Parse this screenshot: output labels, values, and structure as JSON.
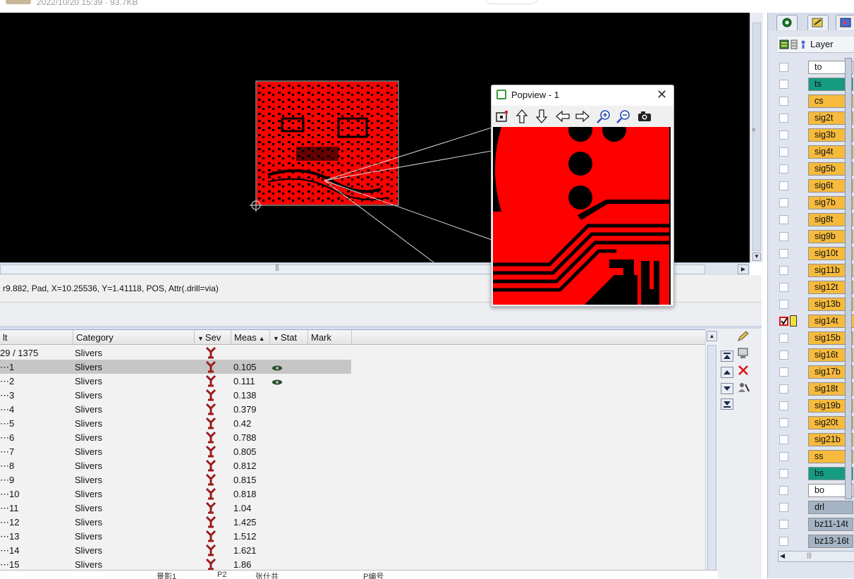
{
  "top_strip": {
    "meta": "2022/10/20 15:39 · 93.7KB"
  },
  "status": {
    "text": "r9.882, Pad, X=10.25536, Y=1.41118, POS, Attr(.drill=via)"
  },
  "popview": {
    "title": "Popview - 1",
    "close": "✕"
  },
  "results": {
    "columns": [
      {
        "label": "lt"
      },
      {
        "label": "Category"
      },
      {
        "label": "Sev"
      },
      {
        "label": "Meas"
      },
      {
        "label": "Stat"
      },
      {
        "label": "Mark"
      }
    ],
    "summary": {
      "count": "29 / 1375",
      "category": "Slivers"
    },
    "rows": [
      {
        "id": "1",
        "category": "Slivers",
        "meas": "0.105",
        "stat": true,
        "selected": true
      },
      {
        "id": "2",
        "category": "Slivers",
        "meas": "0.111",
        "stat": true
      },
      {
        "id": "3",
        "category": "Slivers",
        "meas": "0.138"
      },
      {
        "id": "4",
        "category": "Slivers",
        "meas": "0.379"
      },
      {
        "id": "5",
        "category": "Slivers",
        "meas": "0.42"
      },
      {
        "id": "6",
        "category": "Slivers",
        "meas": "0.788"
      },
      {
        "id": "7",
        "category": "Slivers",
        "meas": "0.805"
      },
      {
        "id": "8",
        "category": "Slivers",
        "meas": "0.812"
      },
      {
        "id": "9",
        "category": "Slivers",
        "meas": "0.815"
      },
      {
        "id": "10",
        "category": "Slivers",
        "meas": "0.818"
      },
      {
        "id": "11",
        "category": "Slivers",
        "meas": "1.04"
      },
      {
        "id": "12",
        "category": "Slivers",
        "meas": "1.425"
      },
      {
        "id": "13",
        "category": "Slivers",
        "meas": "1.512"
      },
      {
        "id": "14",
        "category": "Slivers",
        "meas": "1.621"
      },
      {
        "id": "15",
        "category": "Slivers",
        "meas": "1.86"
      }
    ]
  },
  "bottom_strip": [
    "景影1",
    "P2",
    "张什共",
    "P编号"
  ],
  "layer_panel": {
    "title": "Layer",
    "layers": [
      {
        "name": "to",
        "color": "#ffffff"
      },
      {
        "name": "ts",
        "color": "#159b82"
      },
      {
        "name": "cs",
        "color": "#f6ba3c"
      },
      {
        "name": "sig2t",
        "color": "#f6ba3c"
      },
      {
        "name": "sig3b",
        "color": "#f6ba3c"
      },
      {
        "name": "sig4t",
        "color": "#f6ba3c"
      },
      {
        "name": "sig5b",
        "color": "#f6ba3c"
      },
      {
        "name": "sig6t",
        "color": "#f6ba3c"
      },
      {
        "name": "sig7b",
        "color": "#f6ba3c"
      },
      {
        "name": "sig8t",
        "color": "#f6ba3c"
      },
      {
        "name": "sig9b",
        "color": "#f6ba3c"
      },
      {
        "name": "sig10t",
        "color": "#f6ba3c"
      },
      {
        "name": "sig11b",
        "color": "#f6ba3c"
      },
      {
        "name": "sig12t",
        "color": "#f6ba3c"
      },
      {
        "name": "sig13b",
        "color": "#f6ba3c"
      },
      {
        "name": "sig14t",
        "color": "#f6ba3c",
        "checked": true
      },
      {
        "name": "sig15b",
        "color": "#f6ba3c"
      },
      {
        "name": "sig16t",
        "color": "#f6ba3c"
      },
      {
        "name": "sig17b",
        "color": "#f6ba3c"
      },
      {
        "name": "sig18t",
        "color": "#f6ba3c"
      },
      {
        "name": "sig19b",
        "color": "#f6ba3c"
      },
      {
        "name": "sig20t",
        "color": "#f6ba3c"
      },
      {
        "name": "sig21b",
        "color": "#f6ba3c"
      },
      {
        "name": "ss",
        "color": "#f6ba3c"
      },
      {
        "name": "bs",
        "color": "#159b82"
      },
      {
        "name": "bo",
        "color": "#ffffff"
      },
      {
        "name": "drl",
        "color": "#a4b4c4"
      },
      {
        "name": "bz11-14t",
        "color": "#a4b4c4"
      },
      {
        "name": "bz13-16t",
        "color": "#a4b4c4"
      }
    ]
  },
  "colors": {
    "board": "#ff0000",
    "canvas_bg": "#000000",
    "selection": "#c6c6c6"
  }
}
